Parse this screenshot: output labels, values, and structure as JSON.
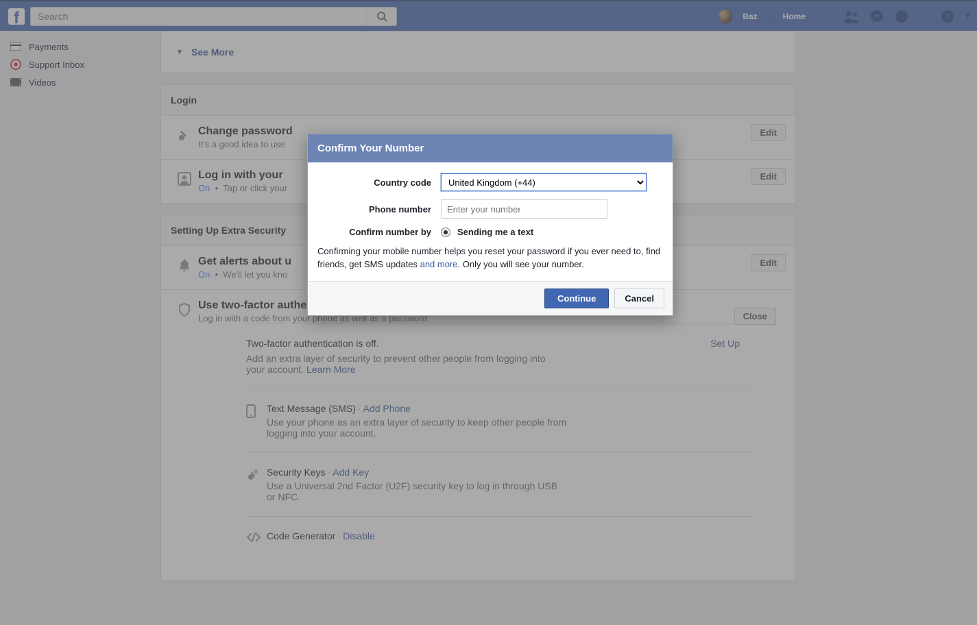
{
  "topbar": {
    "search_placeholder": "Search",
    "profile_name": "Baz",
    "home": "Home"
  },
  "leftnav": {
    "payments": "Payments",
    "support_inbox": "Support Inbox",
    "videos": "Videos"
  },
  "seemore": "See More",
  "login_section": {
    "header": "Login",
    "change_pw_title": "Change password",
    "change_pw_sub": "It's a good idea to use",
    "profile_title": "Log in with your",
    "profile_on": "On",
    "profile_sub": "Tap or click your",
    "edit": "Edit"
  },
  "extra_section": {
    "header": "Setting Up Extra Security",
    "alerts_title": "Get alerts about u",
    "alerts_on": "On",
    "alerts_sub": "We'll let you kno",
    "edit": "Edit",
    "twofa_title": "Use two-factor authentication",
    "twofa_sub": "Log in with a code from your phone as well as a password",
    "close": "Close"
  },
  "twofa": {
    "status_title": "Two-factor authentication is off.",
    "status_sub": "Add an extra layer of security to prevent other people from logging into your account. ",
    "learn_more": "Learn More",
    "setup": "Set Up",
    "sms_title": "Text Message (SMS)",
    "sms_action": "Add Phone",
    "sms_desc": "Use your phone as an extra layer of security to keep other people from logging into your account.",
    "keys_title": "Security Keys",
    "keys_action": "Add Key",
    "keys_desc": "Use a Universal 2nd Factor (U2F) security key to log in through USB or NFC.",
    "codegen_title": "Code Generator",
    "codegen_action": "Disable"
  },
  "modal": {
    "title": "Confirm Your Number",
    "country_label": "Country code",
    "country_value": "United Kingdom (+44)",
    "phone_label": "Phone number",
    "phone_placeholder": "Enter your number",
    "confirm_label": "Confirm number by",
    "confirm_option": "Sending me a text",
    "info_pre": "Confirming your mobile number helps you reset your password if you ever need to, find friends, get SMS updates ",
    "info_link": "and more",
    "info_post": ". Only you will see your number.",
    "continue": "Continue",
    "cancel": "Cancel"
  }
}
